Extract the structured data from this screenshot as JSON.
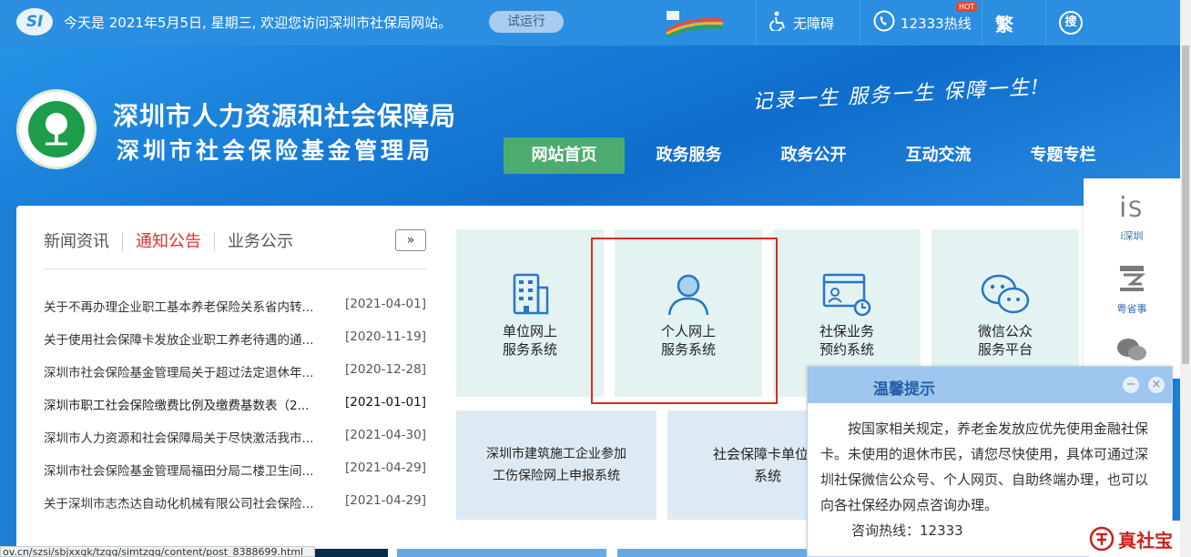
{
  "topbar": {
    "logo_text": "SI",
    "date_text": "今天是 2021年5月5日, 星期三, 欢迎您访问深圳市社保局网站。",
    "trial_label": "试运行",
    "accessibility_label": "无障碍",
    "hotline_label": "12333热线",
    "hot_badge": "HOT",
    "traditional_label": "繁",
    "search_label": "搜"
  },
  "header": {
    "org_name_1": "深圳市人力资源和社会保障局",
    "org_name_2": "深圳市社会保险基金管理局",
    "slogan": "记录一生 服务一生 保障一生!"
  },
  "nav": {
    "items": [
      "网站首页",
      "政务服务",
      "政务公开",
      "互动交流",
      "专题专栏"
    ]
  },
  "news": {
    "tabs": [
      "新闻资讯",
      "通知公告",
      "业务公示"
    ],
    "more_label": "»",
    "items": [
      {
        "title": "关于不再办理企业职工基本养老保险关系省内转...",
        "date": "[2021-04-01]"
      },
      {
        "title": "关于使用社会保障卡发放企业职工养老待遇的通...",
        "date": "[2020-11-19]"
      },
      {
        "title": "深圳市社会保险基金管理局关于超过法定退休年...",
        "date": "[2020-12-28]"
      },
      {
        "title": "深圳市职工社会保险缴费比例及缴费基数表（2...",
        "date": "[2021-01-01]"
      },
      {
        "title": "深圳市人力资源和社会保障局关于尽快激活我市...",
        "date": "[2021-04-30]"
      },
      {
        "title": "深圳市社会保险基金管理局福田分局二楼卫生间...",
        "date": "[2021-04-29]"
      },
      {
        "title": "关于深圳市志杰达自动化机械有限公司社会保险...",
        "date": "[2021-04-29]"
      }
    ]
  },
  "tiles": {
    "t1": {
      "line1": "单位网上",
      "line2": "服务系统"
    },
    "t2": {
      "line1": "个人网上",
      "line2": "服务系统"
    },
    "t3": {
      "line1": "社保业务",
      "line2": "预约系统"
    },
    "t4": {
      "line1": "微信公众",
      "line2": "服务平台"
    },
    "t5": {
      "line1": "深圳市建筑施工企业参加",
      "line2": "工伤保险网上申报系统"
    },
    "t6": {
      "line1": "社会保障卡单位预",
      "line2": "系统"
    }
  },
  "side": {
    "item1": "i深圳",
    "item2": "粤省事"
  },
  "popup": {
    "title": "温馨提示",
    "minimize": "−",
    "close": "×",
    "body": "按国家相关规定，养老金发放应优先使用金融社保卡。未使用的退休市民，请您尽快使用，具体可通过深圳社保微信公众号、个人网页、自助终端办理，也可以向各社保经办网点咨询办理。",
    "hotline": "咨询热线：12333"
  },
  "status": {
    "url": "ov.cn/szsi/sbjxxgk/tzgg/simtzgg/content/post_8388699.html"
  },
  "watermark": {
    "text": "真社宝"
  },
  "colors": {
    "brand_blue": "#1e7ed6",
    "nav_active": "#4cab6e",
    "highlight_red": "#e02a1f",
    "tab_active": "#d9342b"
  }
}
